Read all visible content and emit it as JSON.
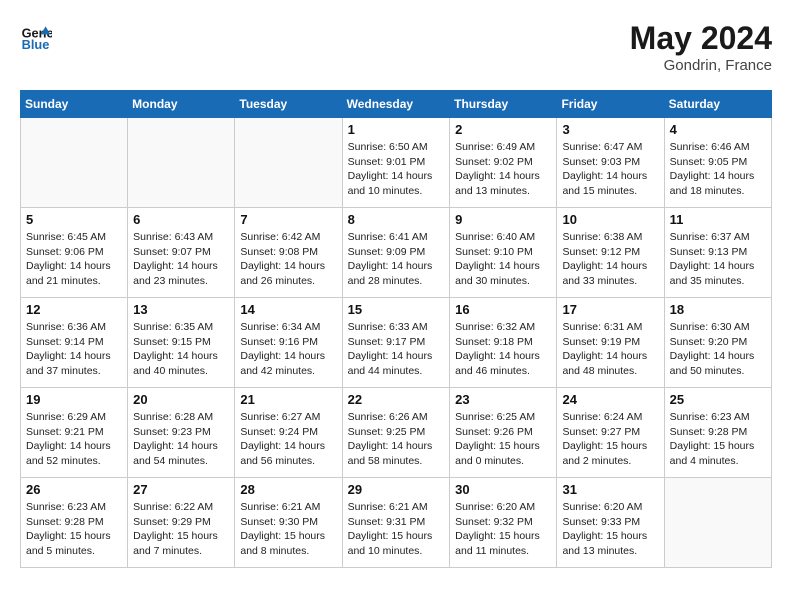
{
  "header": {
    "logo_line1": "General",
    "logo_line2": "Blue",
    "month": "May 2024",
    "location": "Gondrin, France"
  },
  "days_of_week": [
    "Sunday",
    "Monday",
    "Tuesday",
    "Wednesday",
    "Thursday",
    "Friday",
    "Saturday"
  ],
  "weeks": [
    [
      {
        "day": "",
        "info": ""
      },
      {
        "day": "",
        "info": ""
      },
      {
        "day": "",
        "info": ""
      },
      {
        "day": "1",
        "info": "Sunrise: 6:50 AM\nSunset: 9:01 PM\nDaylight: 14 hours\nand 10 minutes."
      },
      {
        "day": "2",
        "info": "Sunrise: 6:49 AM\nSunset: 9:02 PM\nDaylight: 14 hours\nand 13 minutes."
      },
      {
        "day": "3",
        "info": "Sunrise: 6:47 AM\nSunset: 9:03 PM\nDaylight: 14 hours\nand 15 minutes."
      },
      {
        "day": "4",
        "info": "Sunrise: 6:46 AM\nSunset: 9:05 PM\nDaylight: 14 hours\nand 18 minutes."
      }
    ],
    [
      {
        "day": "5",
        "info": "Sunrise: 6:45 AM\nSunset: 9:06 PM\nDaylight: 14 hours\nand 21 minutes."
      },
      {
        "day": "6",
        "info": "Sunrise: 6:43 AM\nSunset: 9:07 PM\nDaylight: 14 hours\nand 23 minutes."
      },
      {
        "day": "7",
        "info": "Sunrise: 6:42 AM\nSunset: 9:08 PM\nDaylight: 14 hours\nand 26 minutes."
      },
      {
        "day": "8",
        "info": "Sunrise: 6:41 AM\nSunset: 9:09 PM\nDaylight: 14 hours\nand 28 minutes."
      },
      {
        "day": "9",
        "info": "Sunrise: 6:40 AM\nSunset: 9:10 PM\nDaylight: 14 hours\nand 30 minutes."
      },
      {
        "day": "10",
        "info": "Sunrise: 6:38 AM\nSunset: 9:12 PM\nDaylight: 14 hours\nand 33 minutes."
      },
      {
        "day": "11",
        "info": "Sunrise: 6:37 AM\nSunset: 9:13 PM\nDaylight: 14 hours\nand 35 minutes."
      }
    ],
    [
      {
        "day": "12",
        "info": "Sunrise: 6:36 AM\nSunset: 9:14 PM\nDaylight: 14 hours\nand 37 minutes."
      },
      {
        "day": "13",
        "info": "Sunrise: 6:35 AM\nSunset: 9:15 PM\nDaylight: 14 hours\nand 40 minutes."
      },
      {
        "day": "14",
        "info": "Sunrise: 6:34 AM\nSunset: 9:16 PM\nDaylight: 14 hours\nand 42 minutes."
      },
      {
        "day": "15",
        "info": "Sunrise: 6:33 AM\nSunset: 9:17 PM\nDaylight: 14 hours\nand 44 minutes."
      },
      {
        "day": "16",
        "info": "Sunrise: 6:32 AM\nSunset: 9:18 PM\nDaylight: 14 hours\nand 46 minutes."
      },
      {
        "day": "17",
        "info": "Sunrise: 6:31 AM\nSunset: 9:19 PM\nDaylight: 14 hours\nand 48 minutes."
      },
      {
        "day": "18",
        "info": "Sunrise: 6:30 AM\nSunset: 9:20 PM\nDaylight: 14 hours\nand 50 minutes."
      }
    ],
    [
      {
        "day": "19",
        "info": "Sunrise: 6:29 AM\nSunset: 9:21 PM\nDaylight: 14 hours\nand 52 minutes."
      },
      {
        "day": "20",
        "info": "Sunrise: 6:28 AM\nSunset: 9:23 PM\nDaylight: 14 hours\nand 54 minutes."
      },
      {
        "day": "21",
        "info": "Sunrise: 6:27 AM\nSunset: 9:24 PM\nDaylight: 14 hours\nand 56 minutes."
      },
      {
        "day": "22",
        "info": "Sunrise: 6:26 AM\nSunset: 9:25 PM\nDaylight: 14 hours\nand 58 minutes."
      },
      {
        "day": "23",
        "info": "Sunrise: 6:25 AM\nSunset: 9:26 PM\nDaylight: 15 hours\nand 0 minutes."
      },
      {
        "day": "24",
        "info": "Sunrise: 6:24 AM\nSunset: 9:27 PM\nDaylight: 15 hours\nand 2 minutes."
      },
      {
        "day": "25",
        "info": "Sunrise: 6:23 AM\nSunset: 9:28 PM\nDaylight: 15 hours\nand 4 minutes."
      }
    ],
    [
      {
        "day": "26",
        "info": "Sunrise: 6:23 AM\nSunset: 9:28 PM\nDaylight: 15 hours\nand 5 minutes."
      },
      {
        "day": "27",
        "info": "Sunrise: 6:22 AM\nSunset: 9:29 PM\nDaylight: 15 hours\nand 7 minutes."
      },
      {
        "day": "28",
        "info": "Sunrise: 6:21 AM\nSunset: 9:30 PM\nDaylight: 15 hours\nand 8 minutes."
      },
      {
        "day": "29",
        "info": "Sunrise: 6:21 AM\nSunset: 9:31 PM\nDaylight: 15 hours\nand 10 minutes."
      },
      {
        "day": "30",
        "info": "Sunrise: 6:20 AM\nSunset: 9:32 PM\nDaylight: 15 hours\nand 11 minutes."
      },
      {
        "day": "31",
        "info": "Sunrise: 6:20 AM\nSunset: 9:33 PM\nDaylight: 15 hours\nand 13 minutes."
      },
      {
        "day": "",
        "info": ""
      }
    ]
  ]
}
